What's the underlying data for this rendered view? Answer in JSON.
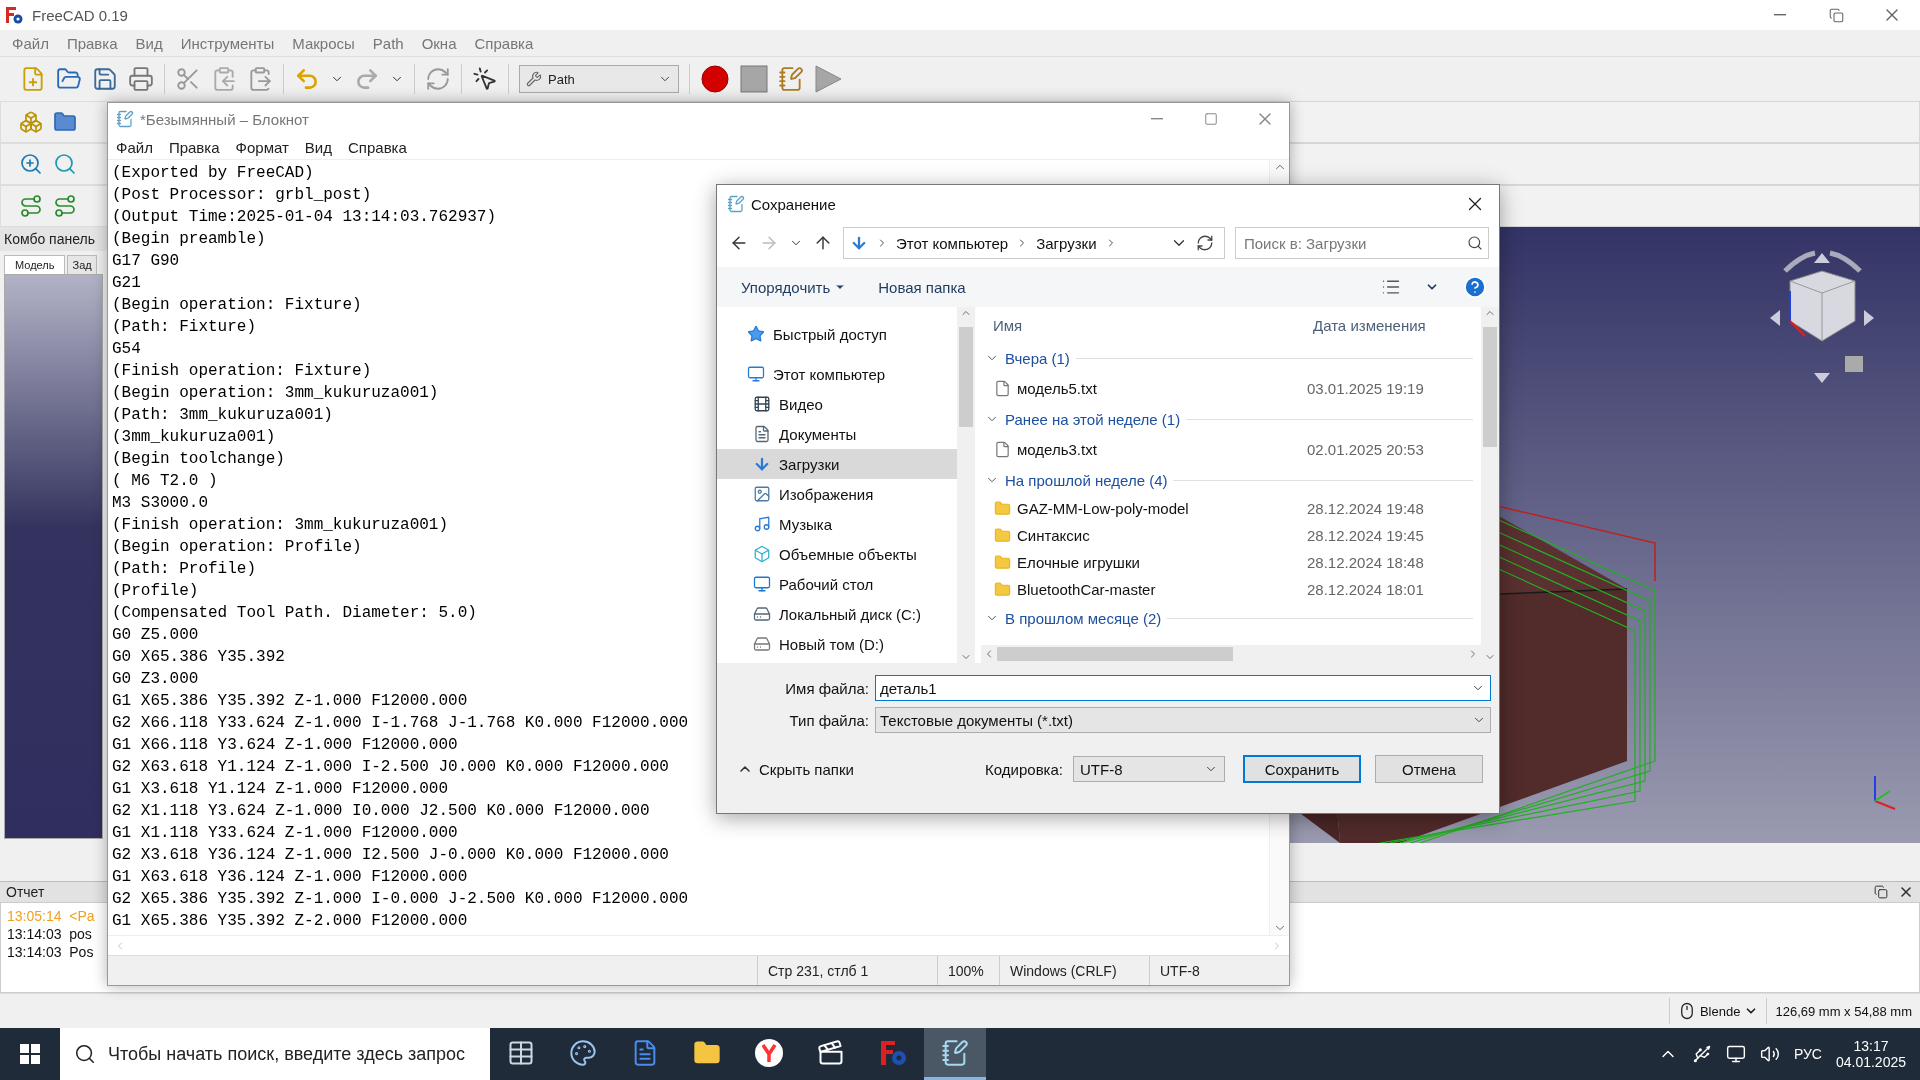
{
  "freecad": {
    "title": "FreeCAD 0.19",
    "menu": [
      "Файл",
      "Правка",
      "Вид",
      "Инструменты",
      "Макросы",
      "Path",
      "Окна",
      "Справка"
    ],
    "workbench": "Path",
    "combo_panel": {
      "title": "Комбо панель",
      "tabs": [
        {
          "label": "Модель",
          "selected": true
        },
        {
          "label": "Зад",
          "selected": false
        }
      ]
    },
    "report": {
      "title": "Отчет",
      "lines": [
        {
          "text": "13:05:14  <Pa",
          "kind": "warning"
        },
        {
          "text": "13:14:03  pos",
          "kind": "message"
        },
        {
          "text": "13:14:03  Pos",
          "kind": "message"
        }
      ]
    },
    "status_bar": {
      "navigation": "Blende",
      "dimensions": "126,69 mm x 54,88 mm"
    }
  },
  "notepad": {
    "title": "*Безымянный – Блокнот",
    "menu": [
      "Файл",
      "Правка",
      "Формат",
      "Вид",
      "Справка"
    ],
    "lines": [
      "(Exported by FreeCAD)",
      "(Post Processor: grbl_post)",
      "(Output Time:2025-01-04 13:14:03.762937)",
      "(Begin preamble)",
      "G17 G90",
      "G21",
      "(Begin operation: Fixture)",
      "(Path: Fixture)",
      "G54",
      "(Finish operation: Fixture)",
      "(Begin operation: 3mm_kukuruza001)",
      "(Path: 3mm_kukuruza001)",
      "(3mm_kukuruza001)",
      "(Begin toolchange)",
      "( M6 T2.0 )",
      "M3 S3000.0",
      "(Finish operation: 3mm_kukuruza001)",
      "(Begin operation: Profile)",
      "(Path: Profile)",
      "(Profile)",
      "(Compensated Tool Path. Diameter: 5.0)",
      "G0 Z5.000",
      "G0 X65.386 Y35.392",
      "G0 Z3.000",
      "G1 X65.386 Y35.392 Z-1.000 F12000.000",
      "G2 X66.118 Y33.624 Z-1.000 I-1.768 J-1.768 K0.000 F12000.000",
      "G1 X66.118 Y3.624 Z-1.000 F12000.000",
      "G2 X63.618 Y1.124 Z-1.000 I-2.500 J0.000 K0.000 F12000.000",
      "G1 X3.618 Y1.124 Z-1.000 F12000.000",
      "G2 X1.118 Y3.624 Z-1.000 I0.000 J2.500 K0.000 F12000.000",
      "G1 X1.118 Y33.624 Z-1.000 F12000.000",
      "G2 X3.618 Y36.124 Z-1.000 I2.500 J-0.000 K0.000 F12000.000",
      "G1 X63.618 Y36.124 Z-1.000 F12000.000",
      "G2 X65.386 Y35.392 Z-1.000 I-0.000 J-2.500 K0.000 F12000.000",
      "G1 X65.386 Y35.392 Z-2.000 F12000.000"
    ],
    "status_bar": [
      "Стр 231, стлб 1",
      "100%",
      "Windows (CRLF)",
      "UTF-8"
    ]
  },
  "save_dialog": {
    "title": "Сохранение",
    "breadcrumb": [
      "Этот компьютер",
      "Загрузки"
    ],
    "search": {
      "placeholder": "Поиск в: Загрузки"
    },
    "toolbar": [
      "Упорядочить",
      "Новая папка"
    ],
    "tree": [
      {
        "label": "Быстрый доступ",
        "selected": false
      },
      {
        "label": "Этот компьютер",
        "selected": false,
        "children": [
          {
            "label": "Видео",
            "selected": false
          },
          {
            "label": "Документы",
            "selected": false
          },
          {
            "label": "Загрузки",
            "selected": true
          },
          {
            "label": "Изображения",
            "selected": false
          },
          {
            "label": "Музыка",
            "selected": false
          },
          {
            "label": "Объемные объекты",
            "selected": false
          },
          {
            "label": "Рабочий стол",
            "selected": false
          },
          {
            "label": "Локальный диск (C:)",
            "selected": false
          },
          {
            "label": "Новый том (D:)",
            "selected": false
          }
        ]
      }
    ],
    "columns": [
      "Имя",
      "Дата изменения"
    ],
    "groups": [
      {
        "label": "Вчера (1)",
        "items": [
          {
            "name": "модель5.txt",
            "date": "03.01.2025 19:19",
            "kind": "file"
          }
        ]
      },
      {
        "label": "Ранее на этой неделе (1)",
        "items": [
          {
            "name": "модель3.txt",
            "date": "02.01.2025 20:53",
            "kind": "file"
          }
        ]
      },
      {
        "label": "На прошлой неделе (4)",
        "items": [
          {
            "name": "GAZ-MM-Low-poly-model",
            "date": "28.12.2024 19:48",
            "kind": "folder"
          },
          {
            "name": "Синтаксис",
            "date": "28.12.2024 19:45",
            "kind": "folder"
          },
          {
            "name": "Елочные игрушки",
            "date": "28.12.2024 18:48",
            "kind": "folder"
          },
          {
            "name": "BluetoothCar-master",
            "date": "28.12.2024 18:01",
            "kind": "folder"
          }
        ]
      },
      {
        "label": "В прошлом месяце (2)"
      }
    ],
    "filename": {
      "label": "Имя файла:",
      "value": "деталь1"
    },
    "filetype": {
      "label": "Тип файла:",
      "value": "Текстовые документы (*.txt)"
    },
    "hide_folders": "Скрыть папки",
    "encoding": {
      "label": "Кодировка:",
      "value": "UTF-8"
    },
    "buttons": [
      {
        "label": "Сохранить",
        "kind": "default"
      },
      {
        "label": "Отмена",
        "kind": "normal"
      }
    ]
  },
  "taskbar": {
    "search": {
      "placeholder": "Чтобы начать поиск, введите здесь запрос"
    },
    "apps": [
      {
        "selected": false
      },
      {
        "selected": false
      },
      {
        "selected": false
      },
      {
        "selected": false
      },
      {
        "selected": false
      },
      {
        "selected": false
      },
      {
        "selected": false
      },
      {
        "selected": true
      }
    ],
    "language": "РУС",
    "time": "13:17",
    "date": "04.01.2025"
  }
}
